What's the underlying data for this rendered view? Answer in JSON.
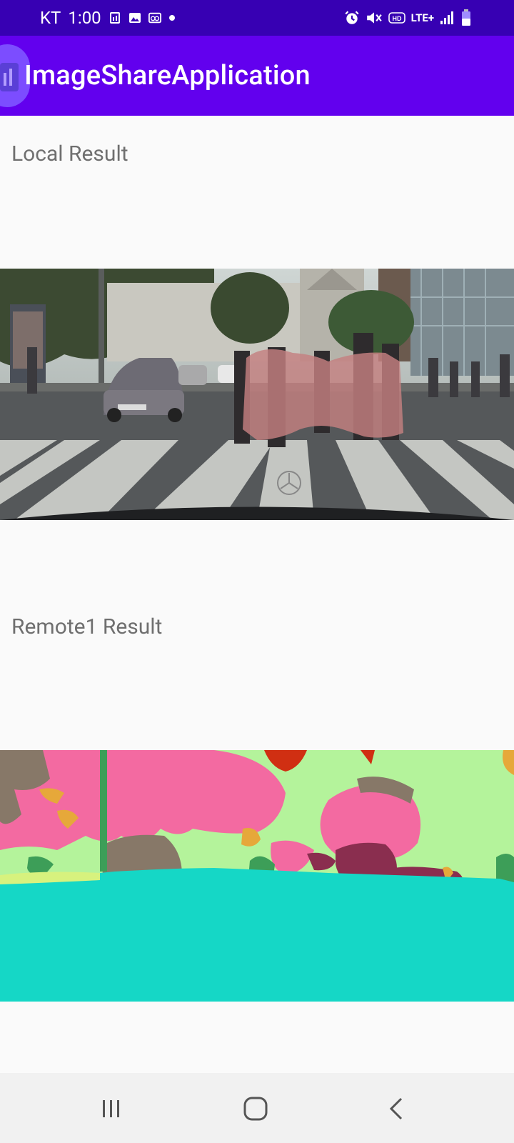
{
  "status_bar": {
    "carrier": "KT",
    "time": "1:00",
    "network": "LTE+",
    "indicators": [
      "notification-icon",
      "gallery-icon",
      "voicemail-icon",
      "dot-icon",
      "alarm-icon",
      "mute-icon",
      "hd-icon",
      "signal-icon",
      "battery-icon"
    ]
  },
  "app_bar": {
    "title": "ImageShareApplication",
    "icon": "app-logo-icon"
  },
  "sections": [
    {
      "label": "Local Result",
      "image": "street-scene-photo-with-segmentation-overlay"
    },
    {
      "label": "Remote1 Result",
      "image": "semantic-segmentation-color-map"
    }
  ],
  "nav_bar": {
    "buttons": [
      "recents-button",
      "home-button",
      "back-button"
    ]
  },
  "colors": {
    "status_bar": "#3700b3",
    "app_bar": "#6200ee",
    "background": "#fafafa",
    "label_text": "#6f6f6f"
  }
}
